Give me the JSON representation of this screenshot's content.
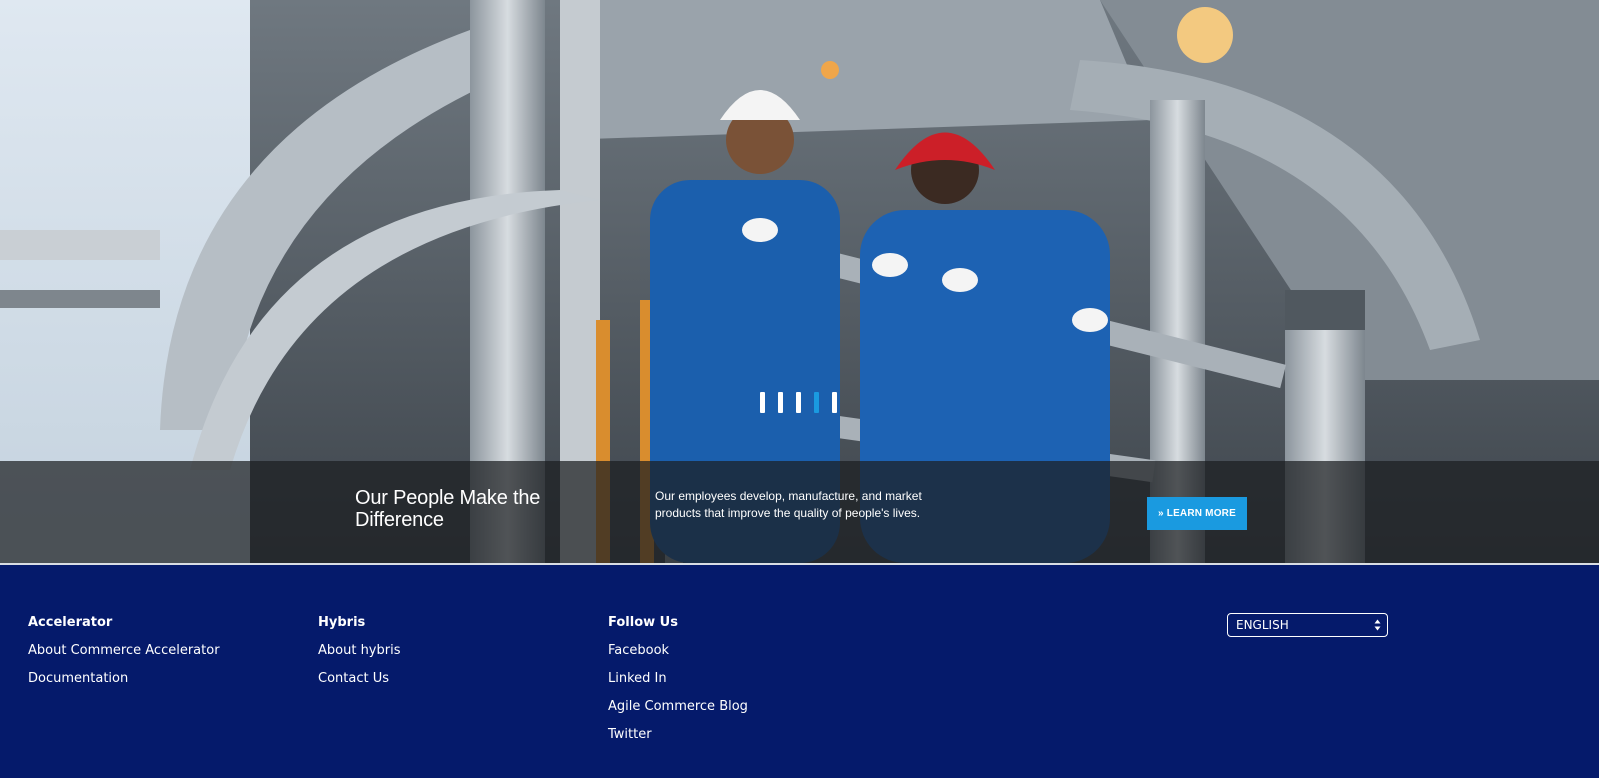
{
  "hero": {
    "title": "Our People Make the Difference",
    "description": "Our employees develop, manufacture, and market products that improve the quality of people's lives.",
    "cta_label": "» LEARN MORE",
    "slides_count": 5,
    "active_slide": 4
  },
  "footer": {
    "columns": [
      {
        "heading": "Accelerator",
        "links": [
          "About Commerce Accelerator",
          "Documentation"
        ]
      },
      {
        "heading": "Hybris",
        "links": [
          "About hybris",
          "Contact Us"
        ]
      },
      {
        "heading": "Follow Us",
        "links": [
          "Facebook",
          "Linked In",
          "Agile Commerce Blog",
          "Twitter"
        ]
      }
    ],
    "language": {
      "selected": "ENGLISH",
      "icon": "select-arrows-icon"
    }
  },
  "colors": {
    "accent": "#1a9ae0",
    "footer_bg": "#051a6b",
    "caption_bg": "#1c1e21"
  }
}
